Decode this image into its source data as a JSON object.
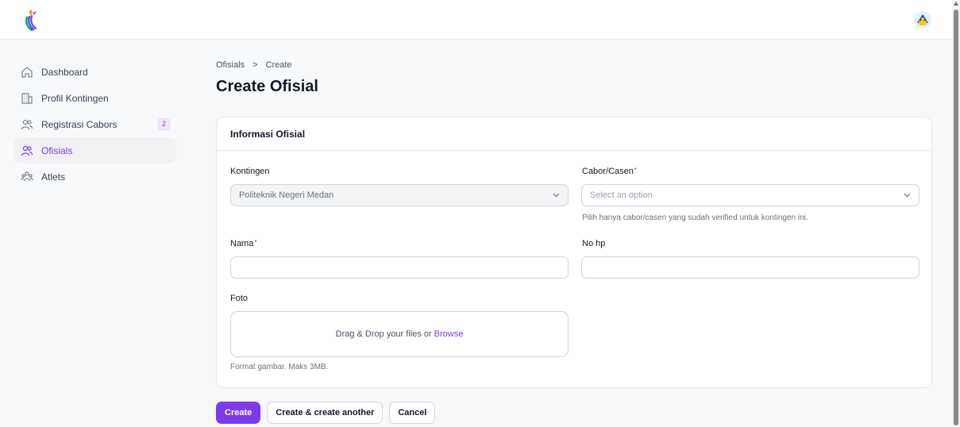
{
  "sidebar": {
    "items": [
      {
        "label": "Dashboard",
        "icon": "home-icon"
      },
      {
        "label": "Profil Kontingen",
        "icon": "building-icon"
      },
      {
        "label": "Registrasi Cabors",
        "icon": "users-icon",
        "badge": "2"
      },
      {
        "label": "Ofisials",
        "icon": "users-icon",
        "active": true
      },
      {
        "label": "Atlets",
        "icon": "users-group-icon"
      }
    ]
  },
  "breadcrumb": {
    "parent": "Ofisials",
    "separator": ">",
    "current": "Create"
  },
  "page": {
    "title": "Create Ofisial"
  },
  "form": {
    "section_title": "Informasi Ofisial",
    "kontingen": {
      "label": "Kontingen",
      "value": "Politeknik Negeri Medan"
    },
    "cabor": {
      "label": "Cabor/Casen",
      "required_mark": "*",
      "placeholder": "Select an option",
      "help": "Pilih hanya cabor/casen yang sudah verified untuk kontingen ini."
    },
    "nama": {
      "label": "Nama",
      "required_mark": "*",
      "value": ""
    },
    "nohp": {
      "label": "No hp",
      "value": ""
    },
    "foto": {
      "label": "Foto",
      "drop_text": "Drag & Drop your files or",
      "browse": "Browse",
      "help": "Format gambar. Maks 3MB."
    }
  },
  "actions": {
    "create": "Create",
    "create_another": "Create & create another",
    "cancel": "Cancel"
  },
  "colors": {
    "accent": "#7c3aed",
    "required": "#dc2626"
  }
}
